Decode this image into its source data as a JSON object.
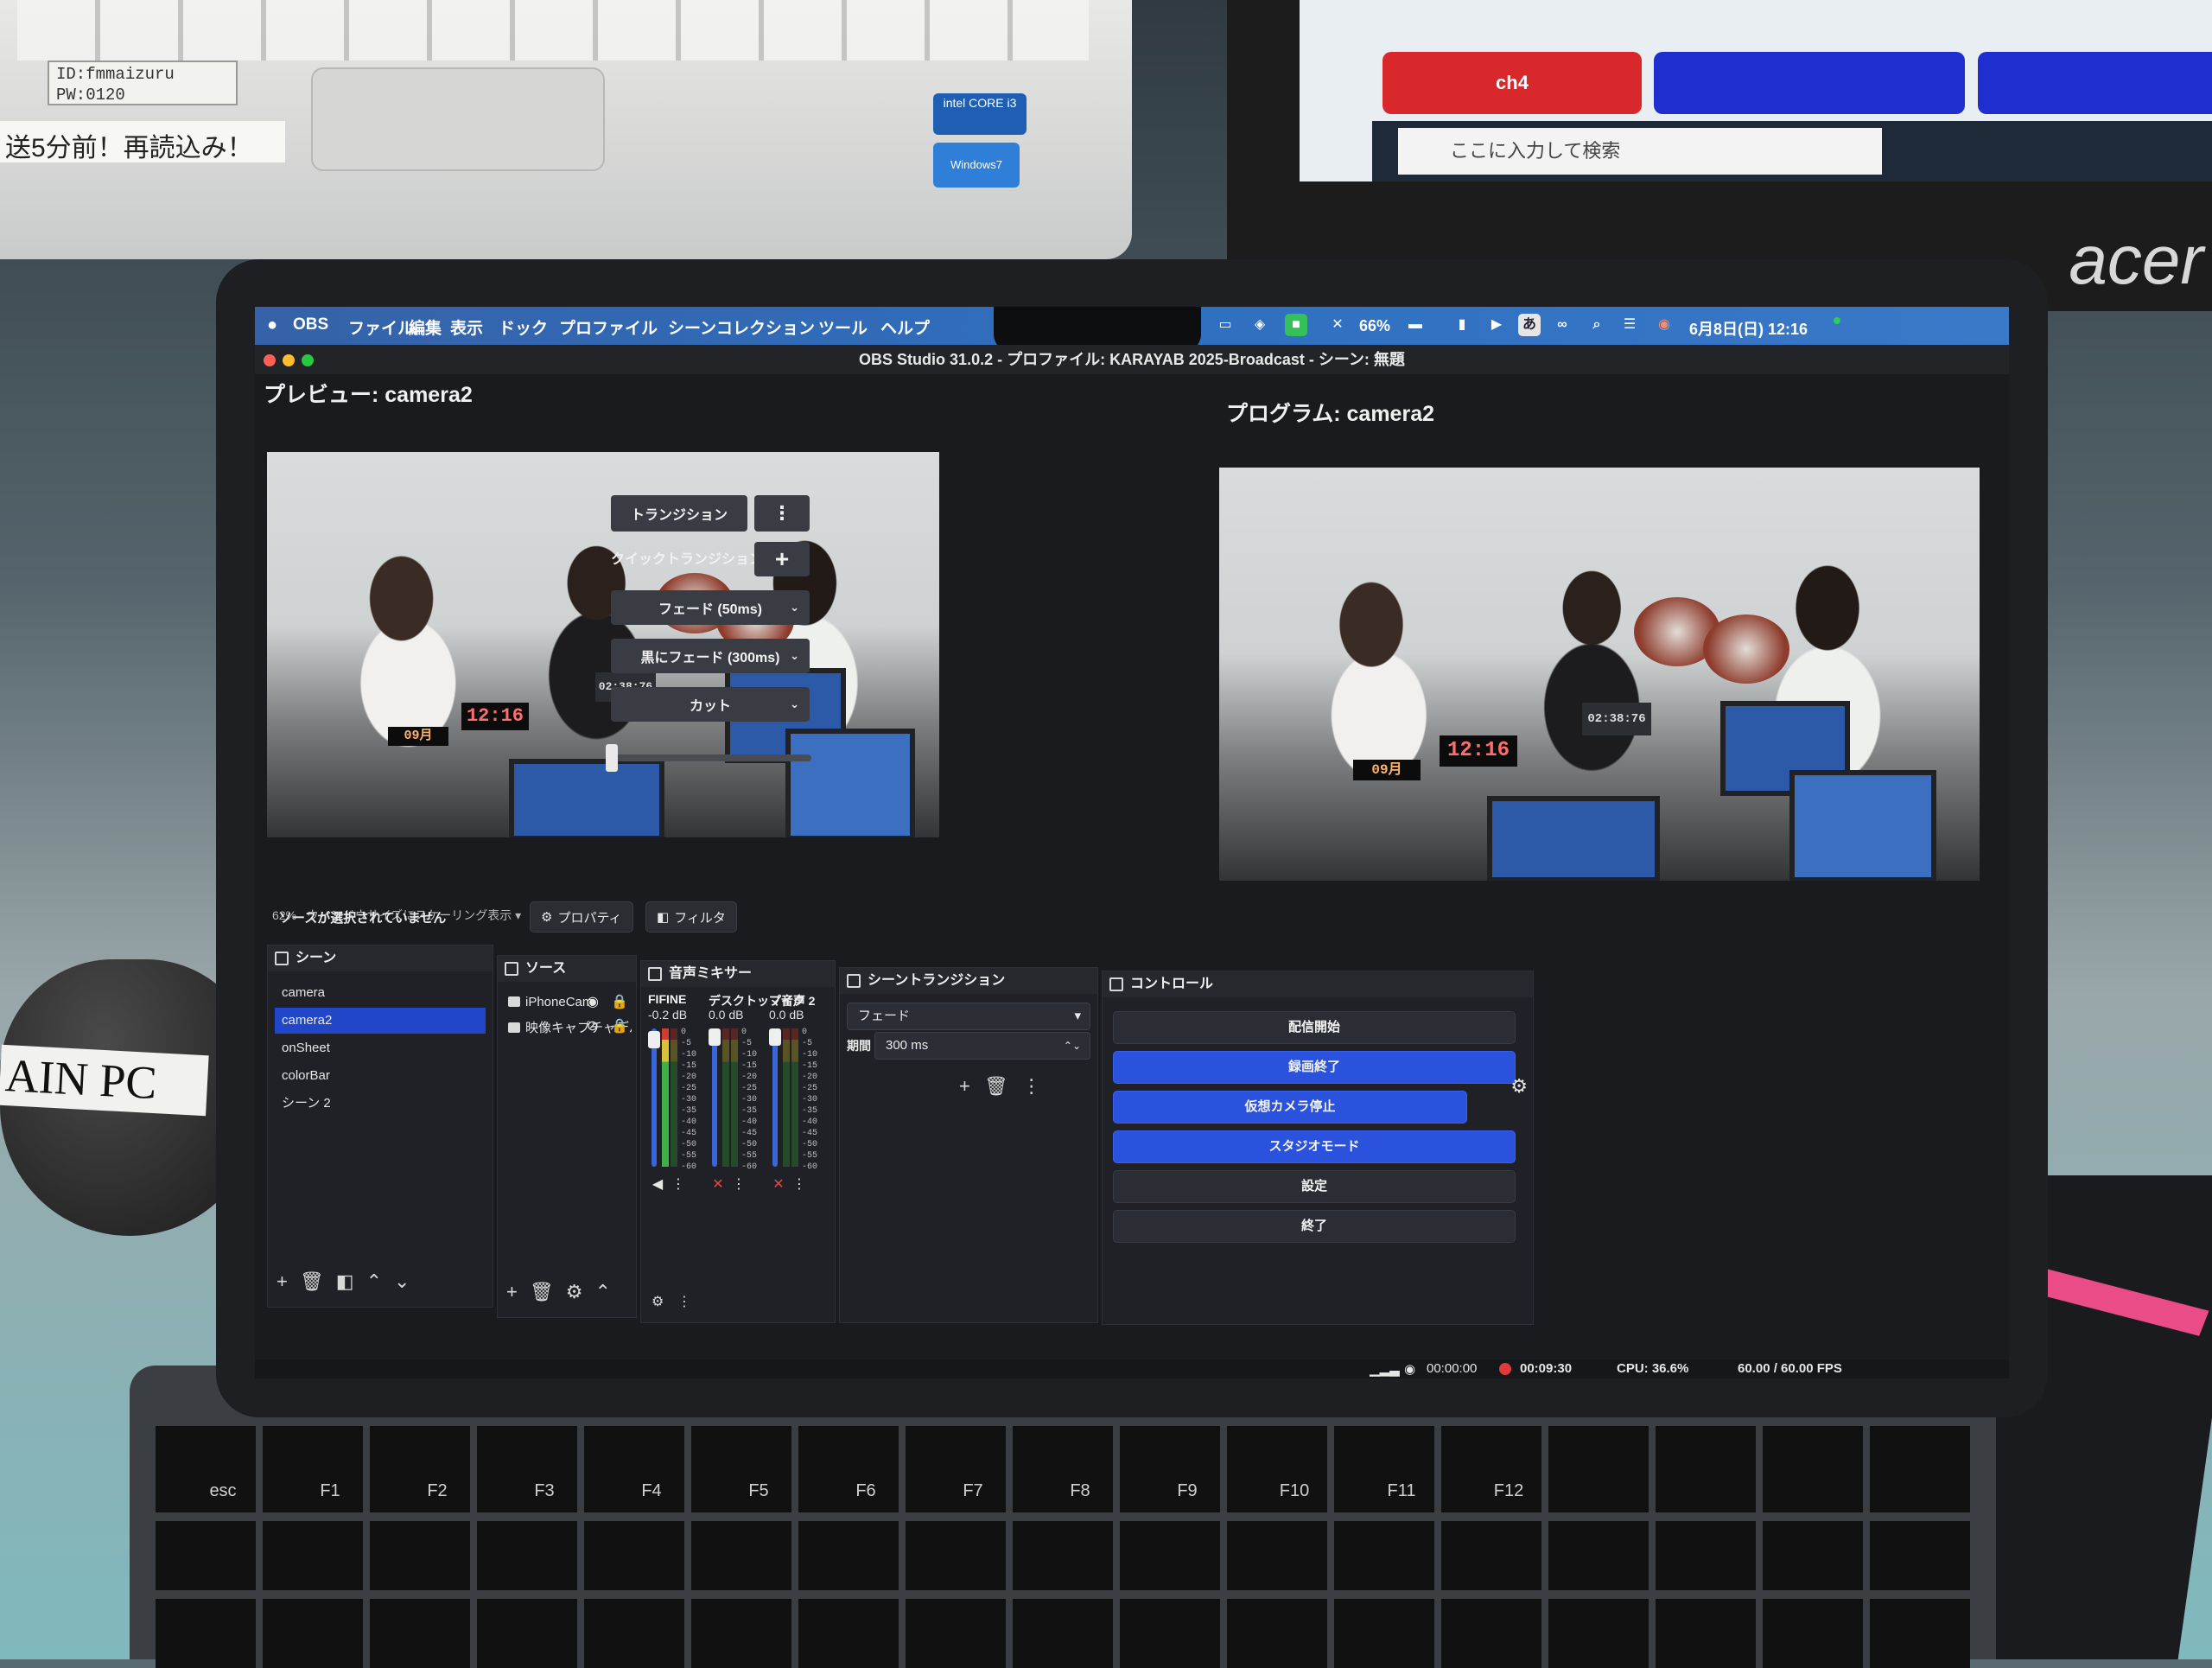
{
  "background": {
    "old_laptop_label": "ID:fmmaizuru\nPW:0120",
    "old_laptop_note": "送5分前！再読込み！",
    "intel_badge": "intel CORE i3",
    "windows_badge": "Windows7",
    "monitor_channel": "ch4",
    "taskbar_search_placeholder": "ここに入力して検索",
    "monitor_brand": "acer",
    "mouse_label": "AIN PC"
  },
  "menubar": {
    "app": "OBS",
    "items": [
      "ファイル",
      "編集",
      "表示",
      "ドック",
      "プロファイル",
      "シーンコレクション",
      "ツール",
      "ヘルプ"
    ],
    "battery": "66%",
    "input_method": "あ",
    "datetime": "6月8日(日) 12:16"
  },
  "window": {
    "title": "OBS Studio 31.0.2 - プロファイル: KARAYAB 2025-Broadcast - シーン: 無題"
  },
  "preview": {
    "label": "プレビュー: camera2",
    "scale_zoom": "62%",
    "scale_text": "ウィンドウサイズにスケーリング表示",
    "lcd_time": "12:16",
    "lcd_date": "09月",
    "tablet_time": "02:38:76"
  },
  "program": {
    "label": "プログラム: camera2"
  },
  "transitions_center": {
    "transition_button": "トランジション",
    "quick_transition": "クイックトランジション",
    "quick": [
      {
        "label": "フェード (50ms)"
      },
      {
        "label": "黒にフェード (300ms)"
      },
      {
        "label": "カット"
      }
    ],
    "slider_position": 0
  },
  "toolbar": {
    "status": "ソースが選択されていません",
    "properties": "プロパティ",
    "filters": "フィルタ"
  },
  "scenes": {
    "title": "シーン",
    "items": [
      "camera",
      "camera2",
      "onSheet",
      "colorBar",
      "シーン 2"
    ],
    "selected": "camera2"
  },
  "sources": {
    "title": "ソース",
    "items": [
      "iPhoneCam",
      "映像キャプチャデバイ..."
    ]
  },
  "mixer": {
    "title": "音声ミキサー",
    "channels": [
      {
        "name": "FIFINE",
        "db": "-0.2 dB",
        "level": 0.98,
        "muted": false
      },
      {
        "name": "デスクトップ音声",
        "db": "0.0 dB",
        "level": 1.0,
        "muted": true
      },
      {
        "name": "マイク 2",
        "db": "0.0 dB",
        "level": 1.0,
        "muted": true
      }
    ],
    "ticks": "0\n-5\n-10\n-15\n-20\n-25\n-30\n-35\n-40\n-45\n-50\n-55\n-60"
  },
  "scene_transition": {
    "title": "シーントランジション",
    "type": "フェード",
    "duration_label": "期間",
    "duration": "300 ms"
  },
  "controls": {
    "title": "コントロール",
    "buttons": [
      {
        "label": "配信開始",
        "active": false
      },
      {
        "label": "録画終了",
        "active": true
      },
      {
        "label": "仮想カメラ停止",
        "active": true
      },
      {
        "label": "スタジオモード",
        "active": true
      },
      {
        "label": "設定",
        "active": false
      },
      {
        "label": "終了",
        "active": false
      }
    ]
  },
  "statusbar": {
    "stream_time": "00:00:00",
    "rec_time": "00:09:30",
    "cpu": "CPU: 36.6%",
    "fps": "60.00 / 60.00 FPS"
  },
  "keyboard": {
    "keys": [
      "esc",
      "F1",
      "F2",
      "F3",
      "F4",
      "F5",
      "F6",
      "F7",
      "F8",
      "F9",
      "F10",
      "F11",
      "F12"
    ]
  },
  "colors": {
    "accent": "#2a52dd",
    "selection": "#2146c8",
    "record": "#e13a3a",
    "menubar": "#2f6fbf"
  }
}
